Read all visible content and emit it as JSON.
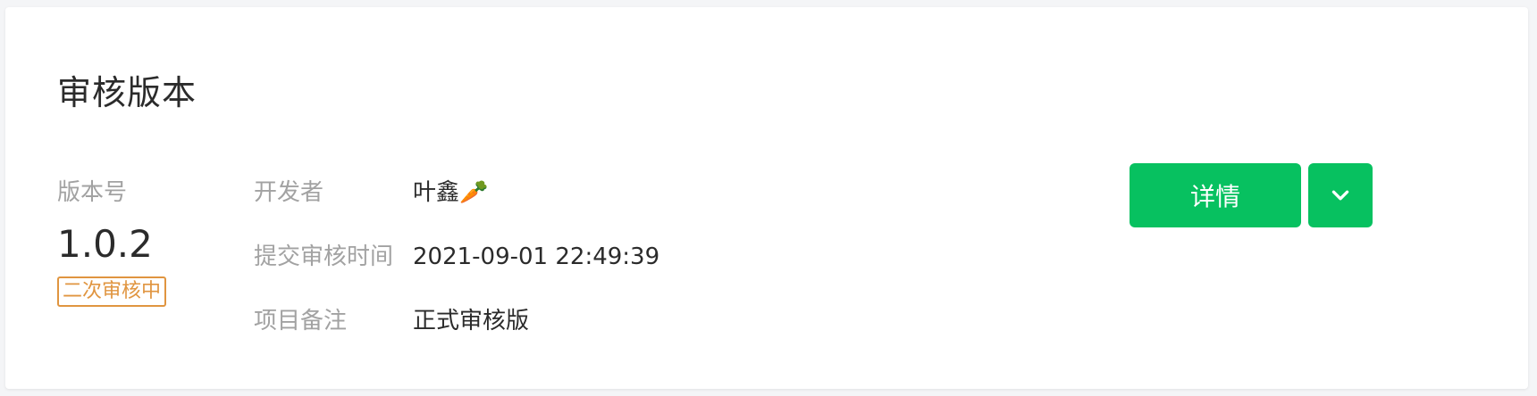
{
  "card": {
    "title": "审核版本"
  },
  "version": {
    "label": "版本号",
    "number": "1.0.2",
    "status": "二次审核中"
  },
  "info": [
    {
      "label": "开发者",
      "value": "叶鑫🥕"
    },
    {
      "label": "提交审核时间",
      "value": "2021-09-01 22:49:39"
    },
    {
      "label": "项目备注",
      "value": "正式审核版"
    }
  ],
  "actions": {
    "detail_label": "详情",
    "dropdown_icon": "chevron-down-icon"
  },
  "colors": {
    "primary": "#07c160",
    "status": "#e09540",
    "label": "#a2a2a2",
    "text": "#2b2b2b"
  }
}
